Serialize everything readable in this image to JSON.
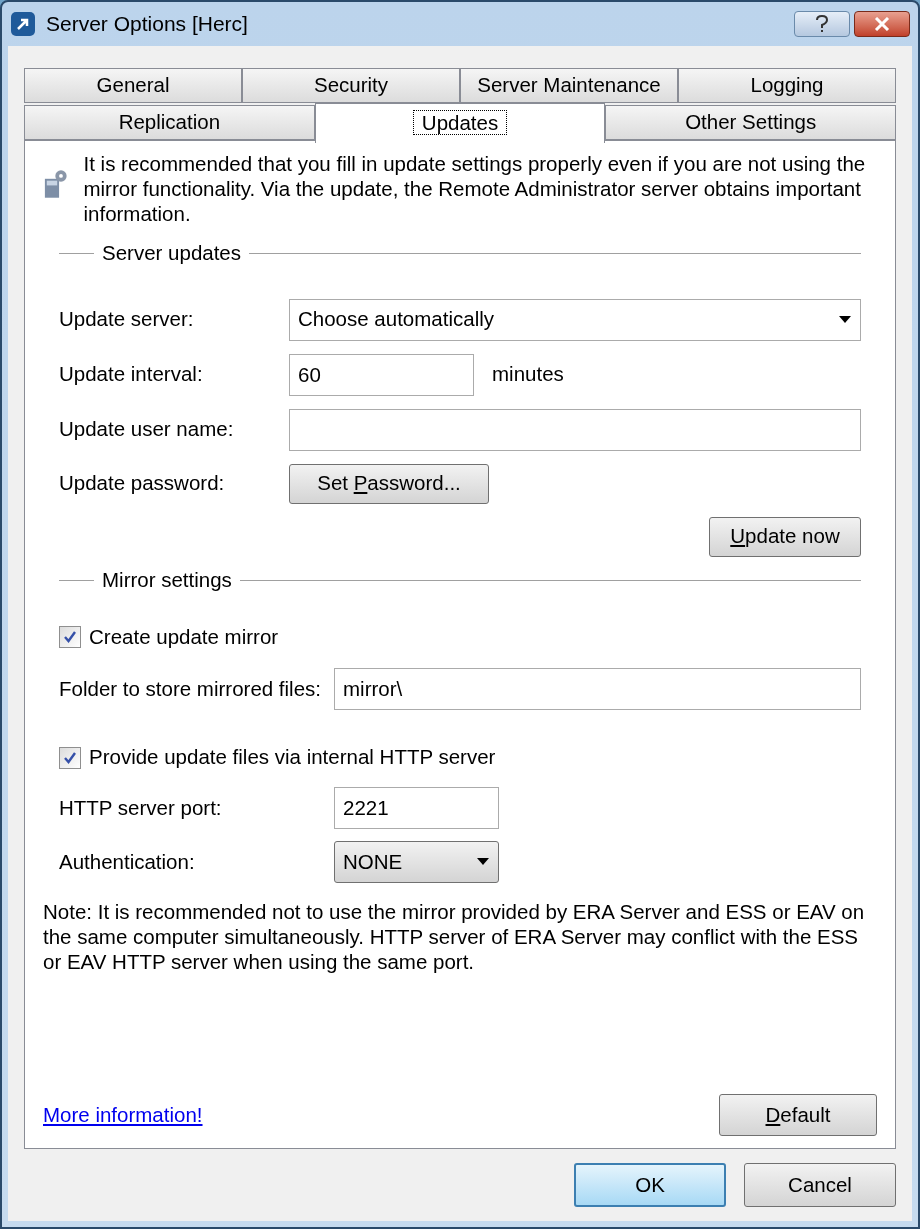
{
  "window": {
    "title": "Server Options [Herc]"
  },
  "tab_rows": [
    [
      {
        "label": "General",
        "selected": false
      },
      {
        "label": "Security",
        "selected": false
      },
      {
        "label": "Server Maintenance",
        "selected": false
      },
      {
        "label": "Logging",
        "selected": false
      }
    ],
    [
      {
        "label": "Replication",
        "selected": false
      },
      {
        "label": "Updates",
        "selected": true
      },
      {
        "label": "Other Settings",
        "selected": false
      }
    ]
  ],
  "intro": "It is recommended that you fill in update settings properly even if you are not using the mirror functionality. Via the update, the Remote Administrator server obtains important information.",
  "server_updates": {
    "title": "Server updates",
    "update_server": {
      "label": "Update server:",
      "value": "Choose automatically"
    },
    "update_interval": {
      "label": "Update interval:",
      "value": "60",
      "unit": "minutes"
    },
    "update_user_name": {
      "label": "Update user name:"
    },
    "update_password": {
      "label": "Update password:",
      "button": {
        "before": "Set ",
        "accel": "P",
        "after": "assword..."
      }
    },
    "update_now": {
      "accel": "U",
      "after": "pdate now"
    }
  },
  "mirror_settings": {
    "title": "Mirror settings",
    "create_mirror": {
      "label": "Create update mirror",
      "checked": true
    },
    "folder": {
      "label": "Folder to store mirrored files:",
      "value": "mirror\\"
    },
    "http_server": {
      "label": "Provide update files via internal HTTP server",
      "checked": true
    },
    "http_port": {
      "label": "HTTP server port:",
      "value": "2221"
    },
    "authentication": {
      "label": "Authentication:",
      "value": "NONE"
    }
  },
  "note": "Note: It is recommended not to use the mirror provided by ERA Server and ESS or EAV on the same computer simultaneously. HTTP server of ERA Server may conflict with the ESS or EAV HTTP server when using the same port.",
  "more_info_link": "More information!",
  "default_button": {
    "accel": "D",
    "after": "efault"
  },
  "buttons": [
    {
      "label": "OK",
      "kind": "default"
    },
    {
      "label": "Cancel",
      "kind": "normal"
    }
  ]
}
